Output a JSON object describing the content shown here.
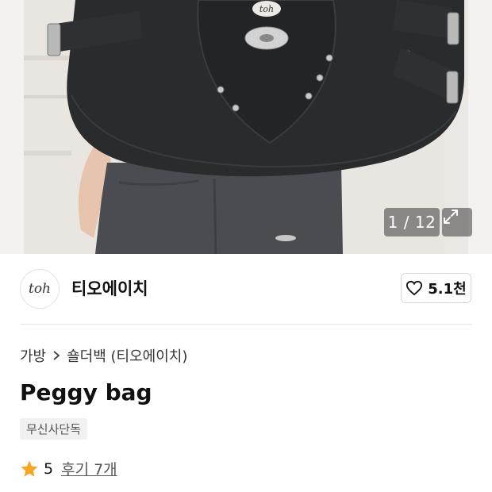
{
  "gallery": {
    "counter": "1 / 12",
    "brand_emblem": "toh",
    "expand_icon": "expand-icon"
  },
  "brand": {
    "logo_text": "toh",
    "name": "티오에이치",
    "like_count": "5.1천"
  },
  "breadcrumb": {
    "category": "가방",
    "subcategory": "숄더백 (티오에이치)"
  },
  "product": {
    "title": "Peggy bag",
    "badge": "무신사단독"
  },
  "rating": {
    "score": "5",
    "reviews_label": "후기 7개",
    "star_color": "#f5a623"
  }
}
